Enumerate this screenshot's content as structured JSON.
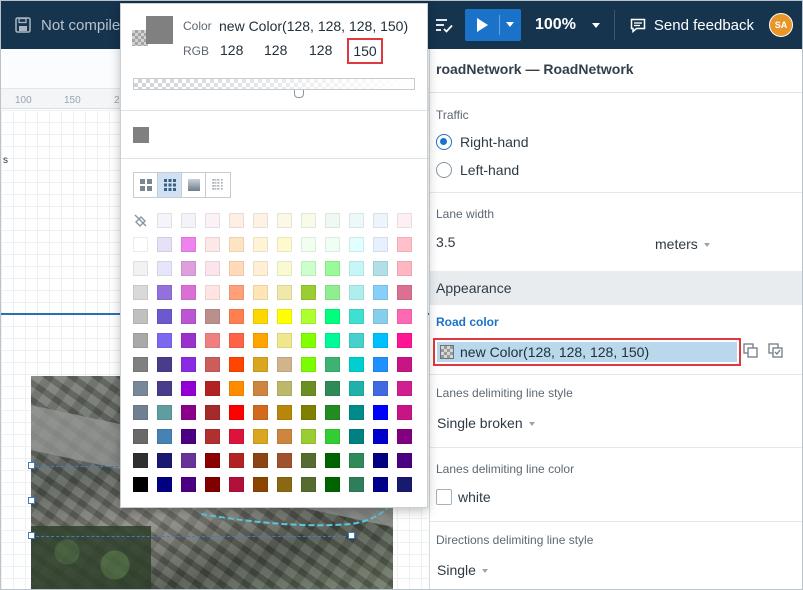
{
  "topbar": {
    "status_label": "Not compiled",
    "zoom": "100%",
    "feedback_label": "Send feedback",
    "avatar_initials": "SA"
  },
  "ruler": {
    "ticks": [
      "100",
      "150",
      "2"
    ]
  },
  "canvas_fragment": "s",
  "picker": {
    "color_label": "Color",
    "color_value": "new Color(128, 128, 128, 150)",
    "rgb_label": "RGB",
    "r": "128",
    "g": "128",
    "b": "128",
    "a": "150",
    "recent_color": "#808080",
    "palette": [
      [
        "none",
        "#f3f5fb",
        "#f5f3fa",
        "#fbf1f6",
        "#fcefe6",
        "#fcf3e6",
        "#fcf8e6",
        "#f7fbe9",
        "#f0f9f1",
        "#edf9f8",
        "#edf4fb",
        "#fcf0f3"
      ],
      [
        "#ffffff",
        "#e6e0f8",
        "#ee82ee",
        "#fde7e7",
        "#ffe4c4",
        "#fff5d6",
        "#fffacd",
        "#f0fff0",
        "#f0fff4",
        "#e0ffff",
        "#e6f0ff",
        "#ffc0cb"
      ],
      [
        "#f2f2f2",
        "#e6e6fa",
        "#dda0dd",
        "#fce4ec",
        "#ffdab9",
        "#ffefd5",
        "#fafad2",
        "#ccffcc",
        "#98fb98",
        "#c6f7f7",
        "#b0e0e6",
        "#ffb6c1"
      ],
      [
        "#d9d9d9",
        "#9370db",
        "#da70d6",
        "#ffe4e1",
        "#ffa07a",
        "#ffe4b5",
        "#eee8aa",
        "#9acd32",
        "#90ee90",
        "#afeeee",
        "#87cefa",
        "#db7093"
      ],
      [
        "#c0c0c0",
        "#6a5acd",
        "#ba55d3",
        "#bc8f8f",
        "#ff7f50",
        "#ffd700",
        "#ffff00",
        "#adff2f",
        "#00ff7f",
        "#40e0d0",
        "#87ceeb",
        "#ff69b4"
      ],
      [
        "#a9a9a9",
        "#7b68ee",
        "#9932cc",
        "#f08080",
        "#ff6347",
        "#ffa500",
        "#f0e68c",
        "#7fff00",
        "#00fa9a",
        "#48d1cc",
        "#00bfff",
        "#ff1493"
      ],
      [
        "#808080",
        "#483d8b",
        "#8a2be2",
        "#cd5c5c",
        "#ff4500",
        "#daa520",
        "#d2b48c",
        "#7cfc00",
        "#3cb371",
        "#00ced1",
        "#1e90ff",
        "#c71585"
      ],
      [
        "#778899",
        "#483d8b",
        "#9400d3",
        "#b22222",
        "#ff8c00",
        "#cd853f",
        "#bdb76b",
        "#6b8e23",
        "#2e8b57",
        "#20b2aa",
        "#4169e1",
        "#d02090"
      ],
      [
        "#708090",
        "#5f9ea0",
        "#8b008b",
        "#a52a2a",
        "#ff0000",
        "#d2691e",
        "#b8860b",
        "#808000",
        "#228b22",
        "#008b8b",
        "#0000ff",
        "#c71585"
      ],
      [
        "#696969",
        "#4682b4",
        "#4b0082",
        "#b03030",
        "#dc143c",
        "#daa520",
        "#cd853f",
        "#9acd32",
        "#32cd32",
        "#008080",
        "#0000cd",
        "#800080"
      ],
      [
        "#2f2f2f",
        "#191970",
        "#663399",
        "#8b0000",
        "#b22222",
        "#8b4513",
        "#a0522d",
        "#556b2f",
        "#006400",
        "#2e8b57",
        "#000080",
        "#4b0082"
      ],
      [
        "#000000",
        "#000080",
        "#4b0082",
        "#800000",
        "#b0103a",
        "#8b4500",
        "#8b6914",
        "#556b2f",
        "#006400",
        "#2e7d5b",
        "#00008b",
        "#191970"
      ]
    ]
  },
  "panel": {
    "title": "roadNetwork — RoadNetwork",
    "traffic_label": "Traffic",
    "traffic_options": [
      "Right-hand",
      "Left-hand"
    ],
    "traffic_selected": "Right-hand",
    "lane_width_label": "Lane width",
    "lane_width_value": "3.5",
    "lane_width_unit": "meters",
    "appearance_label": "Appearance",
    "road_color_label": "Road color",
    "road_color_value": "new Color(128, 128, 128, 150)",
    "lanes_style_label": "Lanes delimiting line style",
    "lanes_style_value": "Single broken",
    "lanes_color_label": "Lanes delimiting line color",
    "lanes_color_value": "white",
    "directions_style_label": "Directions delimiting line style",
    "directions_style_value": "Single"
  }
}
